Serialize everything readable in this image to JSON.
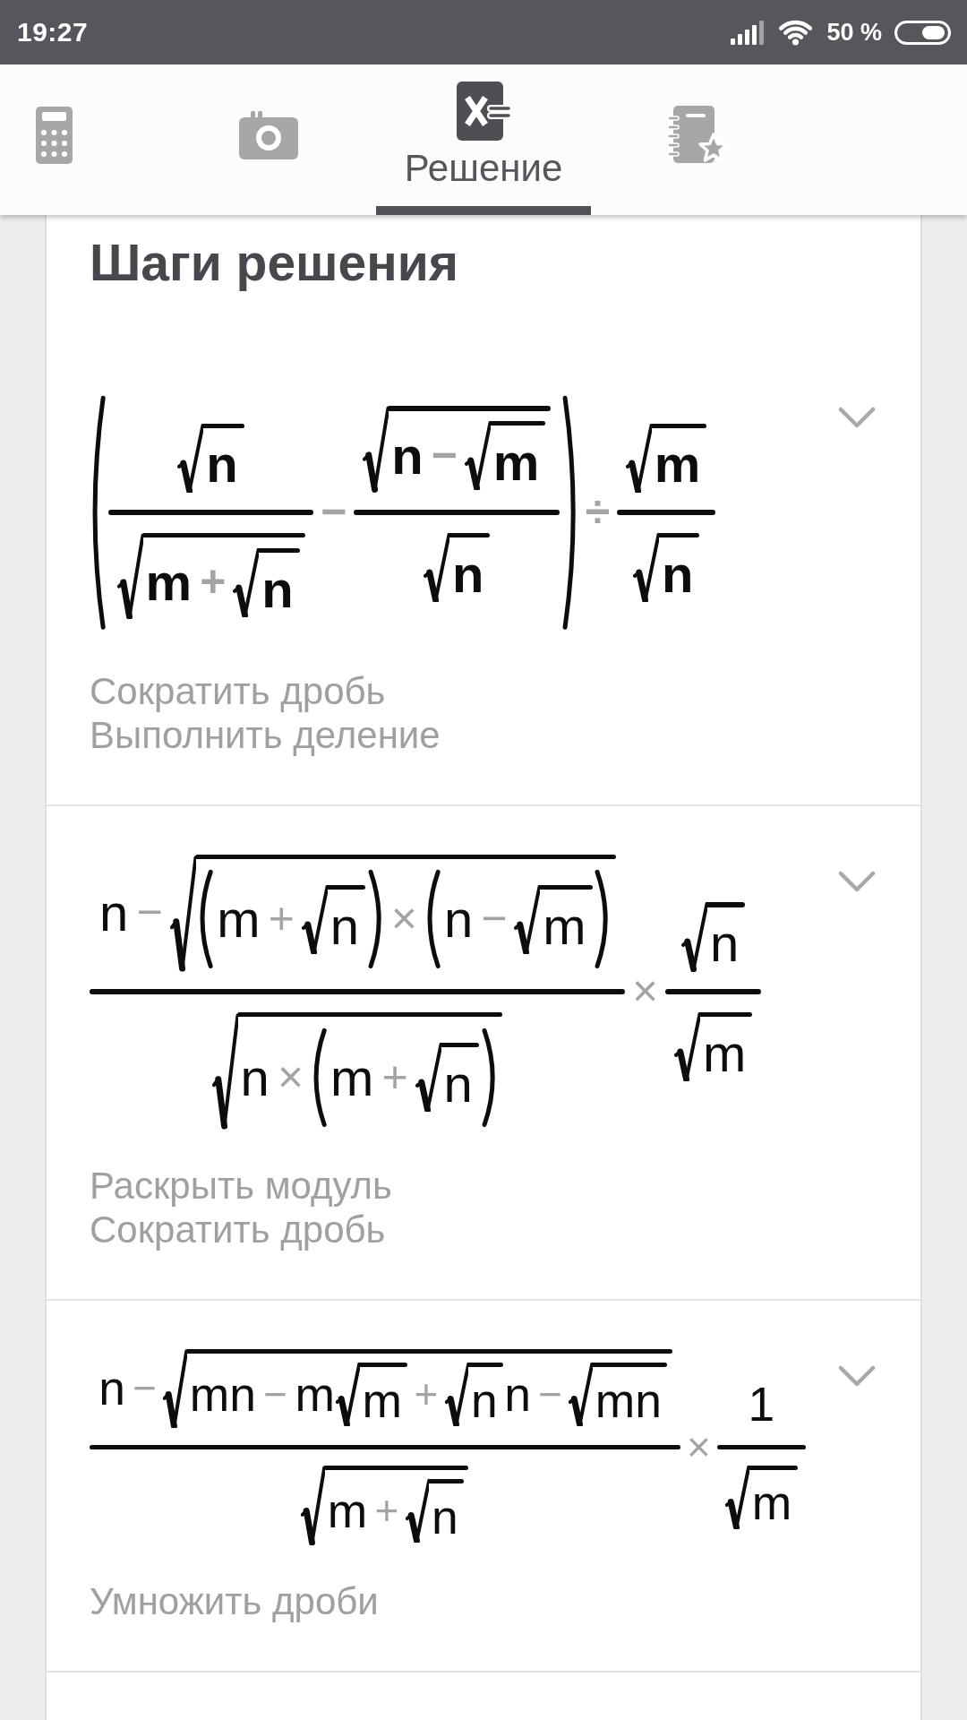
{
  "status_bar": {
    "time": "19:27",
    "battery": "50 %"
  },
  "tabs": [
    {
      "kind": "calculator",
      "selected": false
    },
    {
      "kind": "camera",
      "selected": false
    },
    {
      "kind": "solution",
      "label": "Решение",
      "selected": true
    },
    {
      "kind": "notebook",
      "selected": false
    }
  ],
  "solution": {
    "title": "Шаги решения",
    "steps": [
      {
        "bold": true,
        "expanded": false,
        "formula": [
          {
            "kind": "paren",
            "body": [
              {
                "kind": "frac",
                "num": [
                  {
                    "kind": "sqrt",
                    "body": [
                      {
                        "kind": "var",
                        "text": "n"
                      }
                    ]
                  }
                ],
                "den": [
                  {
                    "kind": "sqrt",
                    "body": [
                      {
                        "kind": "var",
                        "text": "m"
                      },
                      {
                        "kind": "op",
                        "text": "+"
                      },
                      {
                        "kind": "sqrt",
                        "body": [
                          {
                            "kind": "var",
                            "text": "n"
                          }
                        ]
                      }
                    ]
                  }
                ]
              },
              {
                "kind": "op",
                "text": "−"
              },
              {
                "kind": "frac",
                "num": [
                  {
                    "kind": "sqrt",
                    "body": [
                      {
                        "kind": "var",
                        "text": "n"
                      },
                      {
                        "kind": "op",
                        "text": "−"
                      },
                      {
                        "kind": "sqrt",
                        "body": [
                          {
                            "kind": "var",
                            "text": "m"
                          }
                        ]
                      }
                    ]
                  }
                ],
                "den": [
                  {
                    "kind": "sqrt",
                    "body": [
                      {
                        "kind": "var",
                        "text": "n"
                      }
                    ]
                  }
                ]
              }
            ]
          },
          {
            "kind": "op",
            "text": "÷"
          },
          {
            "kind": "frac",
            "num": [
              {
                "kind": "sqrt",
                "body": [
                  {
                    "kind": "var",
                    "text": "m"
                  }
                ]
              }
            ],
            "den": [
              {
                "kind": "sqrt",
                "body": [
                  {
                    "kind": "var",
                    "text": "n"
                  }
                ]
              }
            ]
          }
        ],
        "notes": [
          "Сократить дробь",
          "Выполнить деление"
        ]
      },
      {
        "bold": false,
        "expanded": false,
        "formula": [
          {
            "kind": "frac",
            "num": [
              {
                "kind": "var",
                "text": "n"
              },
              {
                "kind": "op",
                "text": "−"
              },
              {
                "kind": "sqrt",
                "body": [
                  {
                    "kind": "paren",
                    "body": [
                      {
                        "kind": "var",
                        "text": "m"
                      },
                      {
                        "kind": "op",
                        "text": "+"
                      },
                      {
                        "kind": "sqrt",
                        "body": [
                          {
                            "kind": "var",
                            "text": "n"
                          }
                        ]
                      }
                    ]
                  },
                  {
                    "kind": "op",
                    "text": "×"
                  },
                  {
                    "kind": "paren",
                    "body": [
                      {
                        "kind": "var",
                        "text": "n"
                      },
                      {
                        "kind": "op",
                        "text": "−"
                      },
                      {
                        "kind": "sqrt",
                        "body": [
                          {
                            "kind": "var",
                            "text": "m"
                          }
                        ]
                      }
                    ]
                  }
                ]
              }
            ],
            "den": [
              {
                "kind": "sqrt",
                "body": [
                  {
                    "kind": "var",
                    "text": "n"
                  },
                  {
                    "kind": "op",
                    "text": "×"
                  },
                  {
                    "kind": "paren",
                    "body": [
                      {
                        "kind": "var",
                        "text": "m"
                      },
                      {
                        "kind": "op",
                        "text": "+"
                      },
                      {
                        "kind": "sqrt",
                        "body": [
                          {
                            "kind": "var",
                            "text": "n"
                          }
                        ]
                      }
                    ]
                  }
                ]
              }
            ]
          },
          {
            "kind": "op",
            "text": "×"
          },
          {
            "kind": "frac",
            "num": [
              {
                "kind": "sqrt",
                "body": [
                  {
                    "kind": "var",
                    "text": "n"
                  }
                ]
              }
            ],
            "den": [
              {
                "kind": "sqrt",
                "body": [
                  {
                    "kind": "var",
                    "text": "m"
                  }
                ]
              }
            ]
          }
        ],
        "notes": [
          "Раскрыть модуль",
          "Сократить дробь"
        ]
      },
      {
        "bold": false,
        "expanded": false,
        "formula": [
          {
            "kind": "frac",
            "num": [
              {
                "kind": "var",
                "text": "n"
              },
              {
                "kind": "op",
                "text": "−"
              },
              {
                "kind": "sqrt",
                "body": [
                  {
                    "kind": "var",
                    "text": "mn"
                  },
                  {
                    "kind": "op",
                    "text": "−"
                  },
                  {
                    "kind": "var",
                    "text": "m"
                  },
                  {
                    "kind": "sqrt",
                    "body": [
                      {
                        "kind": "var",
                        "text": "m"
                      }
                    ]
                  },
                  {
                    "kind": "op",
                    "text": "+"
                  },
                  {
                    "kind": "sqrt",
                    "body": [
                      {
                        "kind": "var",
                        "text": "n"
                      }
                    ]
                  },
                  {
                    "kind": "var",
                    "text": "n"
                  },
                  {
                    "kind": "op",
                    "text": "−"
                  },
                  {
                    "kind": "sqrt",
                    "body": [
                      {
                        "kind": "var",
                        "text": "mn"
                      }
                    ]
                  }
                ]
              }
            ],
            "den": [
              {
                "kind": "sqrt",
                "body": [
                  {
                    "kind": "var",
                    "text": "m"
                  },
                  {
                    "kind": "op",
                    "text": "+"
                  },
                  {
                    "kind": "sqrt",
                    "body": [
                      {
                        "kind": "var",
                        "text": "n"
                      }
                    ]
                  }
                ]
              }
            ]
          },
          {
            "kind": "op",
            "text": "×"
          },
          {
            "kind": "frac",
            "num": [
              {
                "kind": "num",
                "text": "1"
              }
            ],
            "den": [
              {
                "kind": "sqrt",
                "body": [
                  {
                    "kind": "var",
                    "text": "m"
                  }
                ]
              }
            ]
          }
        ],
        "notes": [
          "Умножить дроби"
        ]
      }
    ]
  }
}
